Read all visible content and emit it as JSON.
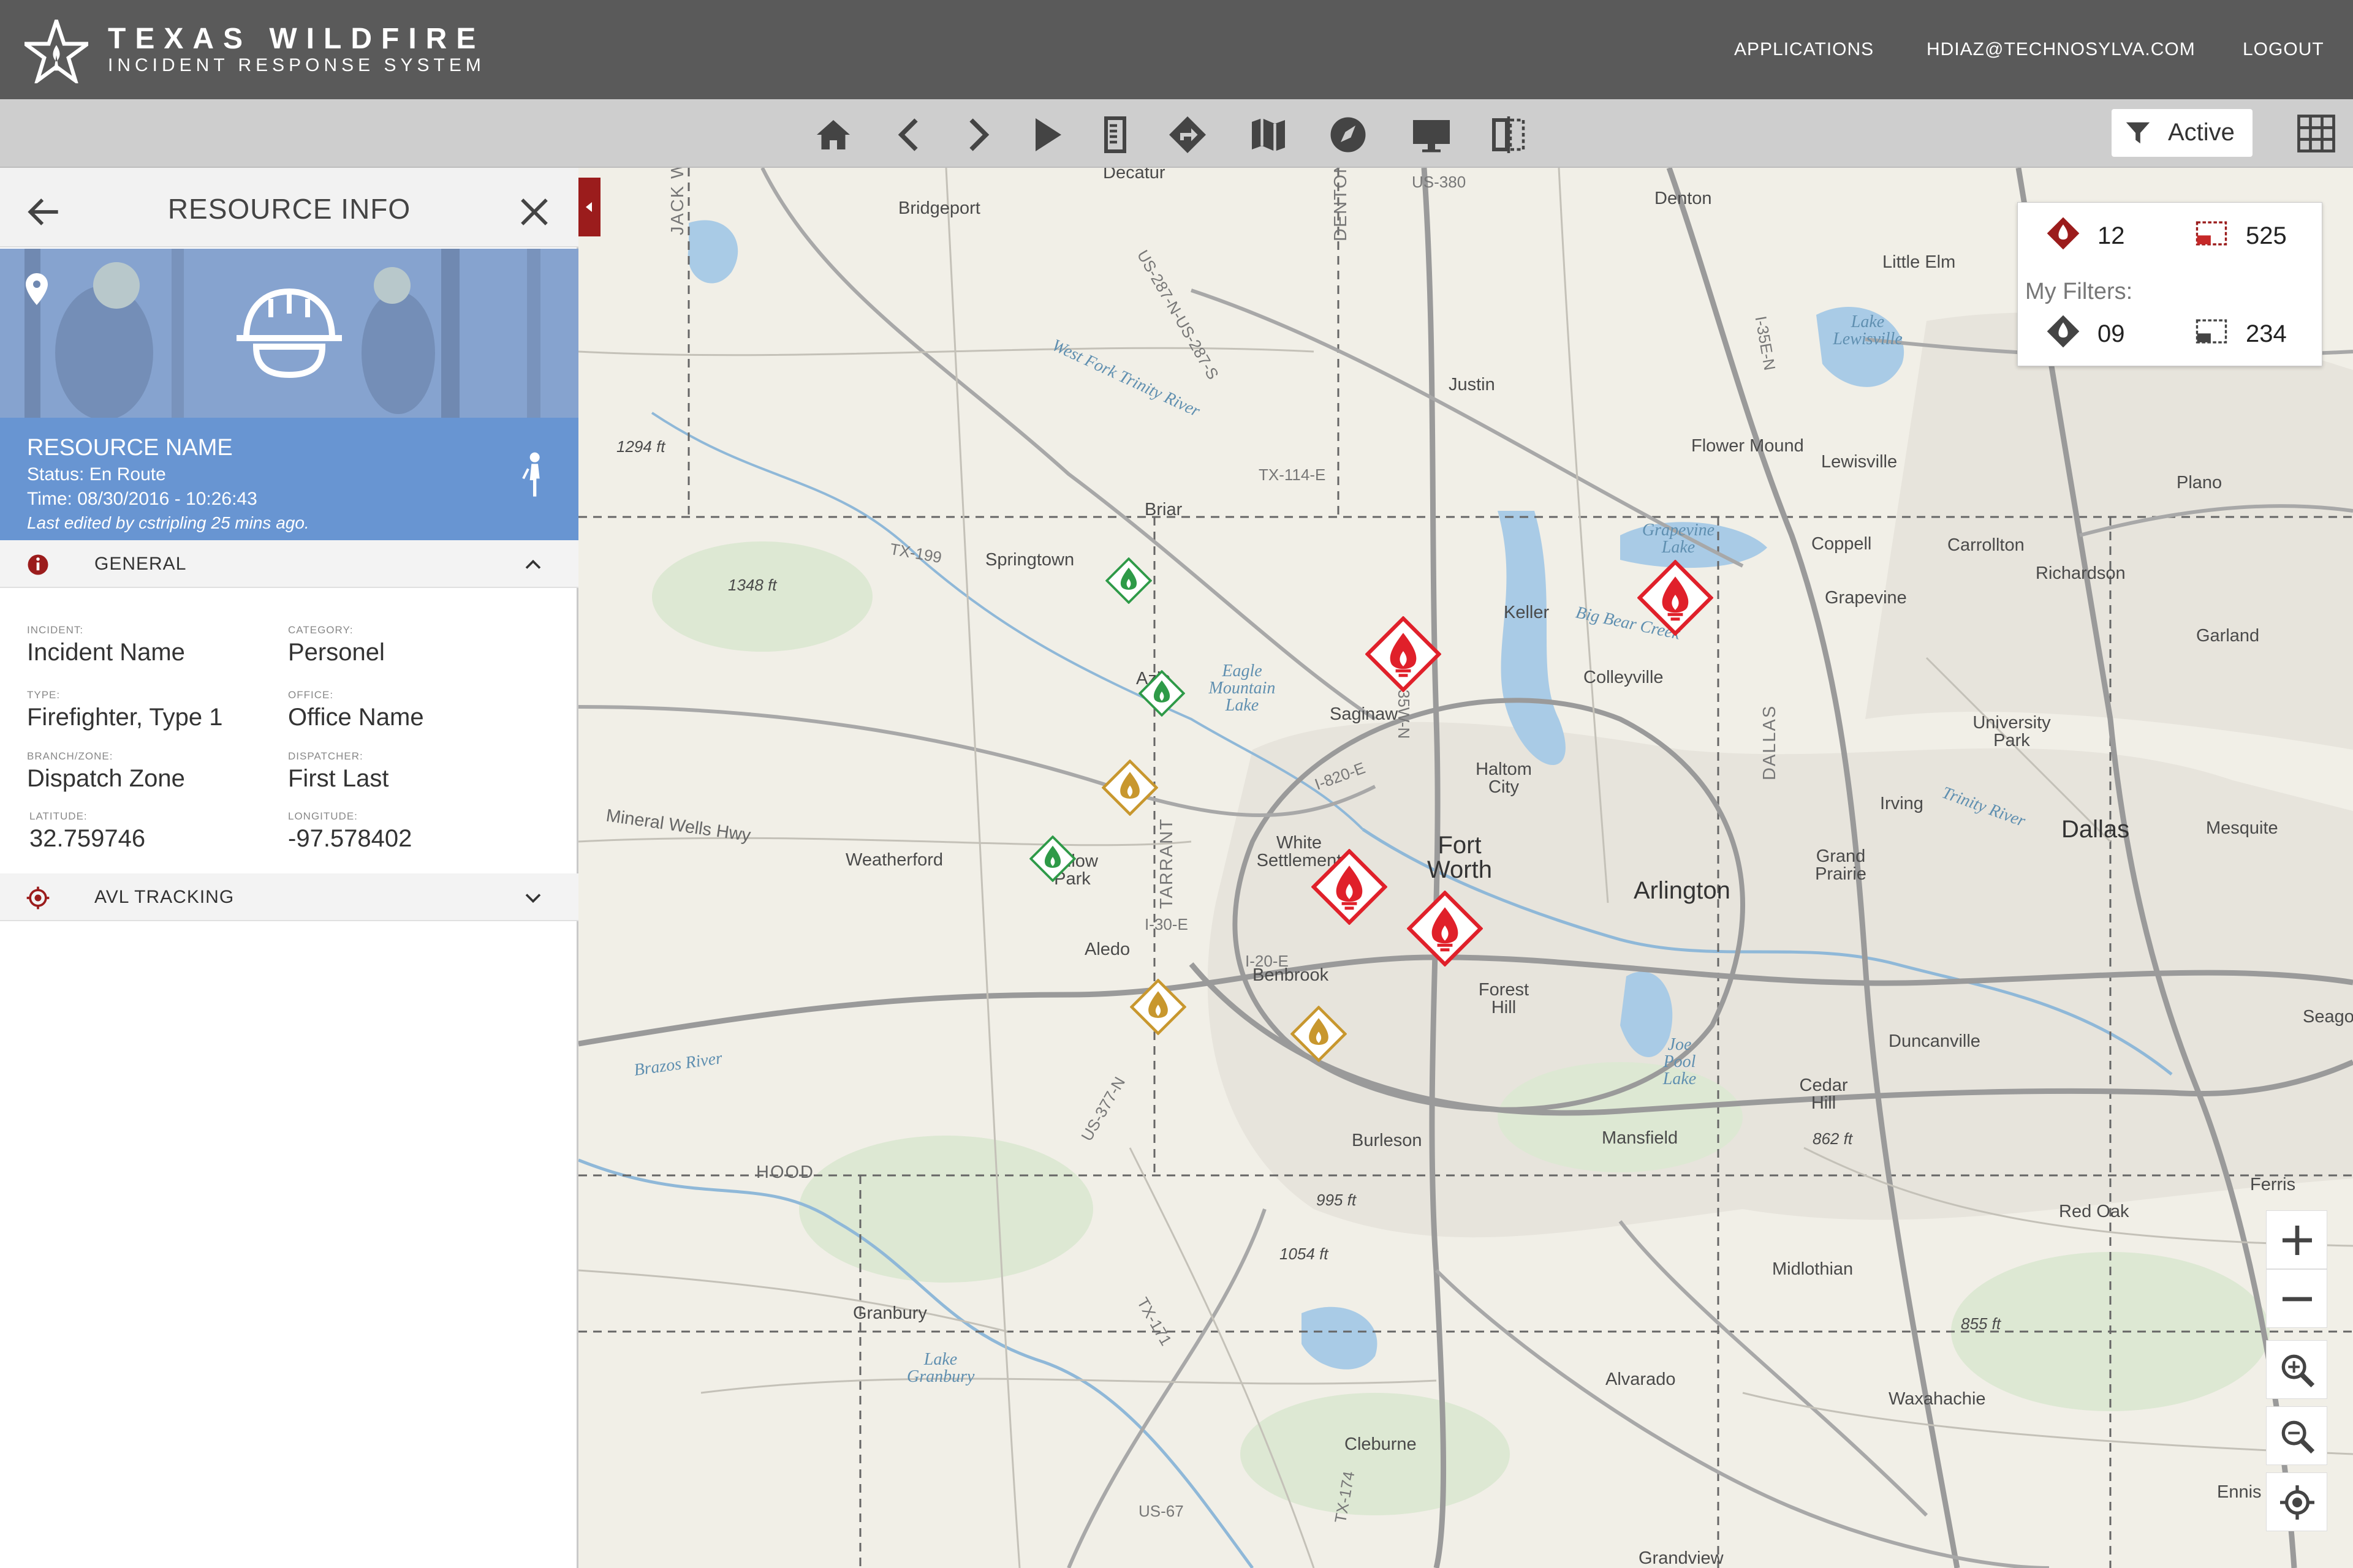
{
  "header": {
    "title": "TEXAS WILDFIRE",
    "subtitle": "INCIDENT RESPONSE SYSTEM",
    "nav": {
      "applications": "APPLICATIONS",
      "user": "HDIAZ@TECHNOSYLVA.COM",
      "logout": "LOGOUT"
    }
  },
  "toolbar": {
    "tools": [
      "home-icon",
      "chevron-left-icon",
      "chevron-right-icon",
      "play-icon",
      "notes-icon",
      "directions-icon",
      "map-icon",
      "compass-icon",
      "monitor-icon",
      "split-view-icon"
    ],
    "filter_label": "Active"
  },
  "panel": {
    "title": "RESOURCE INFO",
    "resource": {
      "name": "RESOURCE NAME",
      "status": "Status: En Route",
      "time": "Time: 08/30/2016 - 10:26:43",
      "edited": "Last edited by cstripling 25 mins ago."
    },
    "general_label": "GENERAL",
    "fields": {
      "incident": {
        "label": "INCIDENT:",
        "value": "Incident Name"
      },
      "category": {
        "label": "CATEGORY:",
        "value": "Personel"
      },
      "type": {
        "label": "TYPE:",
        "value": "Firefighter, Type 1"
      },
      "office": {
        "label": "OFFICE:",
        "value": "Office Name"
      },
      "branch": {
        "label": "BRANCH/ZONE:",
        "value": "Dispatch Zone"
      },
      "dispatcher": {
        "label": "DISPATCHER:",
        "value": "First Last"
      },
      "latitude": {
        "label": "LATITUDE:",
        "value": "32.759746"
      },
      "longitude": {
        "label": "LONGITUDE:",
        "value": "-97.578402"
      }
    },
    "avl_label": "AVL TRACKING"
  },
  "stats": {
    "fires_total": "12",
    "areas_total": "525",
    "my_filters_label": "My Filters:",
    "fires_filtered": "09",
    "areas_filtered": "234"
  },
  "map": {
    "labels": {
      "decatur": "Decatur",
      "bridgeport": "Bridgeport",
      "denton": "Denton",
      "little_elm": "Little Elm",
      "justin": "Justin",
      "flower_mound": "Flower Mound",
      "lewisville": "Lewisville",
      "plano": "Plano",
      "carrollton": "Carrollton",
      "richardson": "Richardson",
      "garland": "Garland",
      "briar": "Briar",
      "springtown": "Springtown",
      "keller": "Keller",
      "grapevine": "Grapevine",
      "coppell": "Coppell",
      "azle": "Azle",
      "saginaw": "Saginaw",
      "colleyville": "Colleyville",
      "university_park": "University Park",
      "haltom_city": "Haltom City",
      "irving": "Irving",
      "dallas": "Dallas",
      "mesquite": "Mesquite",
      "weatherford": "Weatherford",
      "willow_park": "Willow Park",
      "white_settlement": "White Settlement",
      "fort_worth": "Fort Worth",
      "arlington": "Arlington",
      "grand_prairie": "Grand Prairie",
      "aledo": "Aledo",
      "benbrook": "Benbrook",
      "forest_hill": "Forest Hill",
      "duncanville": "Duncanville",
      "seagoville": "Seagoville",
      "cedar_hill": "Cedar Hill",
      "burleson": "Burleson",
      "mansfield": "Mansfield",
      "red_oak": "Red Oak",
      "ferris": "Ferris",
      "midlothian": "Midlothian",
      "granbury": "Granbury",
      "alvarado": "Alvarado",
      "waxahachie": "Waxahachie",
      "cleburne": "Cleburne",
      "ennis": "Ennis",
      "grandview": "Grandview",
      "hood": "HOOD",
      "jack_wise": "JACK WISE",
      "denton_county": "DENTON",
      "tarrant": "TARRANT",
      "dallas_county": "DALLAS",
      "lake_lewisville": "Lake Lewisville",
      "grapevine_lake": "Grapevine Lake",
      "eagle_mountain_lake": "Eagle Mountain Lake",
      "joe_pool_lake": "Joe Pool Lake",
      "lake_granbury": "Lake Granbury",
      "brazos_river": "Brazos River",
      "west_fork": "West Fork Trinity River",
      "big_bear_creek": "Big Bear Creek",
      "mineral_wells_hwy": "Mineral Wells Hwy",
      "trinity_river": "Trinity River",
      "e1294": "1294 ft",
      "e1348": "1348 ft",
      "e995": "995 ft",
      "e1054": "1054 ft",
      "e862": "862 ft",
      "e855": "855 ft",
      "i35w": "I-35W-N",
      "i35e": "I-35E-N",
      "i30": "I-30-E",
      "i20": "I-20-E",
      "i820": "I-820-E",
      "us380": "US-380",
      "us287": "US-287-N-US-287-S",
      "tx114": "TX-114-E",
      "tx199": "TX-199",
      "us377": "US-377-N",
      "us67": "US-67",
      "tx171": "TX-171",
      "tx174": "TX-174"
    },
    "markers": [
      {
        "id": "fire-1",
        "color": "#e0202a",
        "size": "large"
      },
      {
        "id": "fire-2",
        "color": "#e0202a",
        "size": "large"
      },
      {
        "id": "fire-3",
        "color": "#e0202a",
        "size": "large"
      },
      {
        "id": "fire-4",
        "color": "#e0202a",
        "size": "large"
      },
      {
        "id": "fire-5",
        "color": "#c8972e",
        "size": "medium"
      },
      {
        "id": "fire-6",
        "color": "#c8972e",
        "size": "medium"
      },
      {
        "id": "fire-7",
        "color": "#c8972e",
        "size": "medium"
      },
      {
        "id": "fire-8",
        "color": "#2e9a48",
        "size": "small"
      },
      {
        "id": "fire-9",
        "color": "#2e9a48",
        "size": "small"
      },
      {
        "id": "fire-10",
        "color": "#2e9a48",
        "size": "small"
      }
    ]
  },
  "colors": {
    "header_bg": "#5a5a5a",
    "toolbar_bg": "#cecece",
    "accent_red": "#9b1c1c",
    "resource_blue": "#6895d2",
    "fire_active": "#e0202a",
    "fire_contained": "#c8972e",
    "fire_controlled": "#2e9a48"
  }
}
